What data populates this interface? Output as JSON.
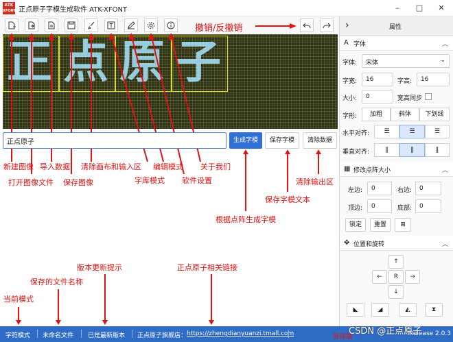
{
  "window": {
    "logo_text": "ATK",
    "logo_text2": "XFONT",
    "title": "正点原子字模生成软件 ATK-XFONT",
    "min_icon": "–",
    "max_icon": "□",
    "close_icon": "✕"
  },
  "canvas": {
    "glyphs": [
      "正",
      "点",
      "原",
      "子"
    ]
  },
  "input": {
    "value": "正点原子"
  },
  "buttons": {
    "generate": "生成字模",
    "save": "保存字模",
    "clear": "清除数据"
  },
  "annotations": {
    "undo_redo": "撤销/反撤销",
    "new_image": "新建图像",
    "open_image": "打开图像文件",
    "import_data": "导入数据",
    "save_image": "保存图像",
    "clear_canvas": "清除画布和输入区",
    "font_mode": "字库模式",
    "edit_mode": "编辑模式",
    "settings": "软件设置",
    "about": "关于我们",
    "clear_output": "清除输出区",
    "save_text": "保存字模文本",
    "generate_from_matrix": "根据点阵生成字模",
    "version_tip": "版本更新提示",
    "link": "正点原子相关链接",
    "saved_name": "保存的文件名称",
    "current_mode": "当前模式",
    "current_version": "当前版"
  },
  "status": {
    "mode": "字符模式",
    "file": "未命名文件",
    "version": "已是最新版本",
    "link_label": "正点原子旗舰店：",
    "link_url": "https://zhengdianyuanzi.tmall.com",
    "release": "Release 2.0.3"
  },
  "watermark": "CSDN @正点原子",
  "panel": {
    "header": "属性",
    "font_section": "字体",
    "font_label": "字体:",
    "font_value": "宋体",
    "width_label": "字宽:",
    "width_value": "16",
    "height_label": "字高:",
    "height_value": "16",
    "size_label": "大小:",
    "size_value": "0",
    "sync_label": "宽高同步",
    "style_label": "字形:",
    "bold": "加粗",
    "italic": "斜体",
    "underline": "下划线",
    "h_align_label": "水平对齐:",
    "v_align_label": "垂直对齐:",
    "matrix_section": "修改点阵大小",
    "left_label": "左边:",
    "left_value": "0",
    "right_label": "右边:",
    "right_value": "0",
    "top_label": "顶边:",
    "top_value": "0",
    "bottom_label": "底部:",
    "bottom_value": "0",
    "lock": "锁定",
    "reset": "重置",
    "position_section": "位置和旋转",
    "up": "↑",
    "left": "←",
    "center": "R",
    "right": "→",
    "down": "↓"
  }
}
